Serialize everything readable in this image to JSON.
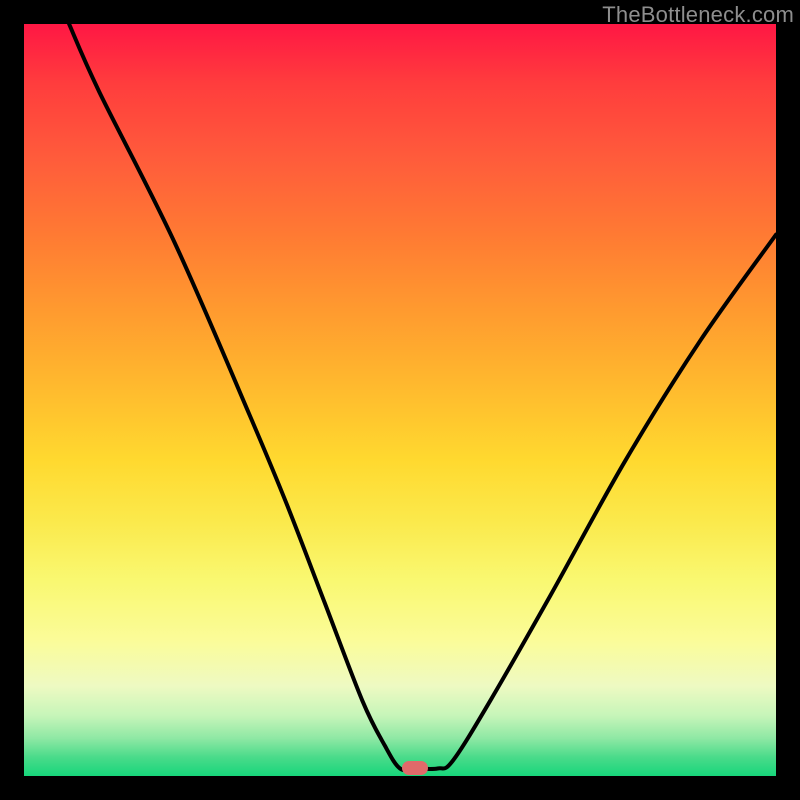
{
  "attribution": "TheBottleneck.com",
  "colors": {
    "frame": "#000000",
    "marker": "#e06a6a",
    "curve": "#000000",
    "gradient_top": "#ff1744",
    "gradient_bottom": "#17d67b"
  },
  "chart_data": {
    "type": "line",
    "title": "",
    "xlabel": "",
    "ylabel": "",
    "xlim": [
      0,
      100
    ],
    "ylim": [
      0,
      100
    ],
    "grid": false,
    "legend": false,
    "series": [
      {
        "name": "bottleneck-curve",
        "x": [
          6,
          10,
          20,
          30,
          35,
          40,
          45,
          48,
          50,
          52,
          55,
          57,
          62,
          70,
          80,
          90,
          100
        ],
        "values": [
          100,
          91,
          71,
          48,
          36,
          23,
          10,
          4,
          1,
          1,
          1,
          2,
          10,
          24,
          42,
          58,
          72
        ]
      }
    ],
    "marker": {
      "x": 52,
      "y": 1
    }
  }
}
